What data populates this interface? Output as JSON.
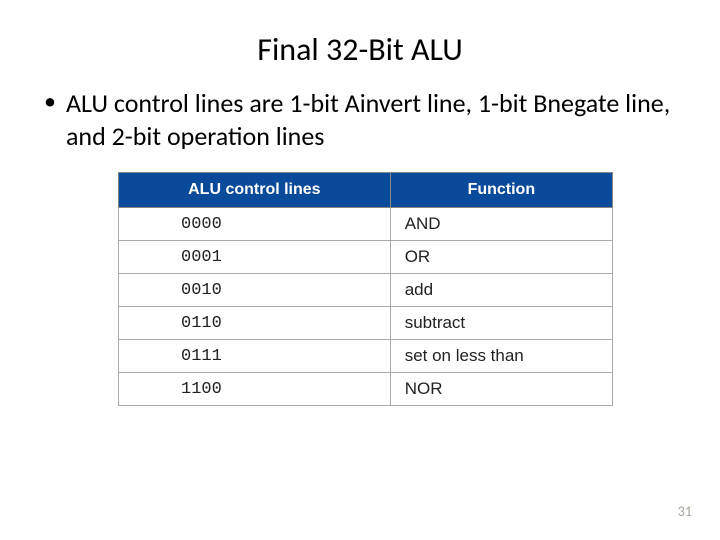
{
  "title": "Final 32-Bit ALU",
  "bullet": "ALU control lines are 1-bit Ainvert line, 1-bit Bnegate line, and 2-bit operation lines",
  "table": {
    "headers": {
      "col1": "ALU control lines",
      "col2": "Function"
    },
    "rows": [
      {
        "code": "0000",
        "func": "AND"
      },
      {
        "code": "0001",
        "func": "OR"
      },
      {
        "code": "0010",
        "func": "add"
      },
      {
        "code": "0110",
        "func": "subtract"
      },
      {
        "code": "0111",
        "func": "set on less than"
      },
      {
        "code": "1100",
        "func": "NOR"
      }
    ]
  },
  "page_number": "31"
}
